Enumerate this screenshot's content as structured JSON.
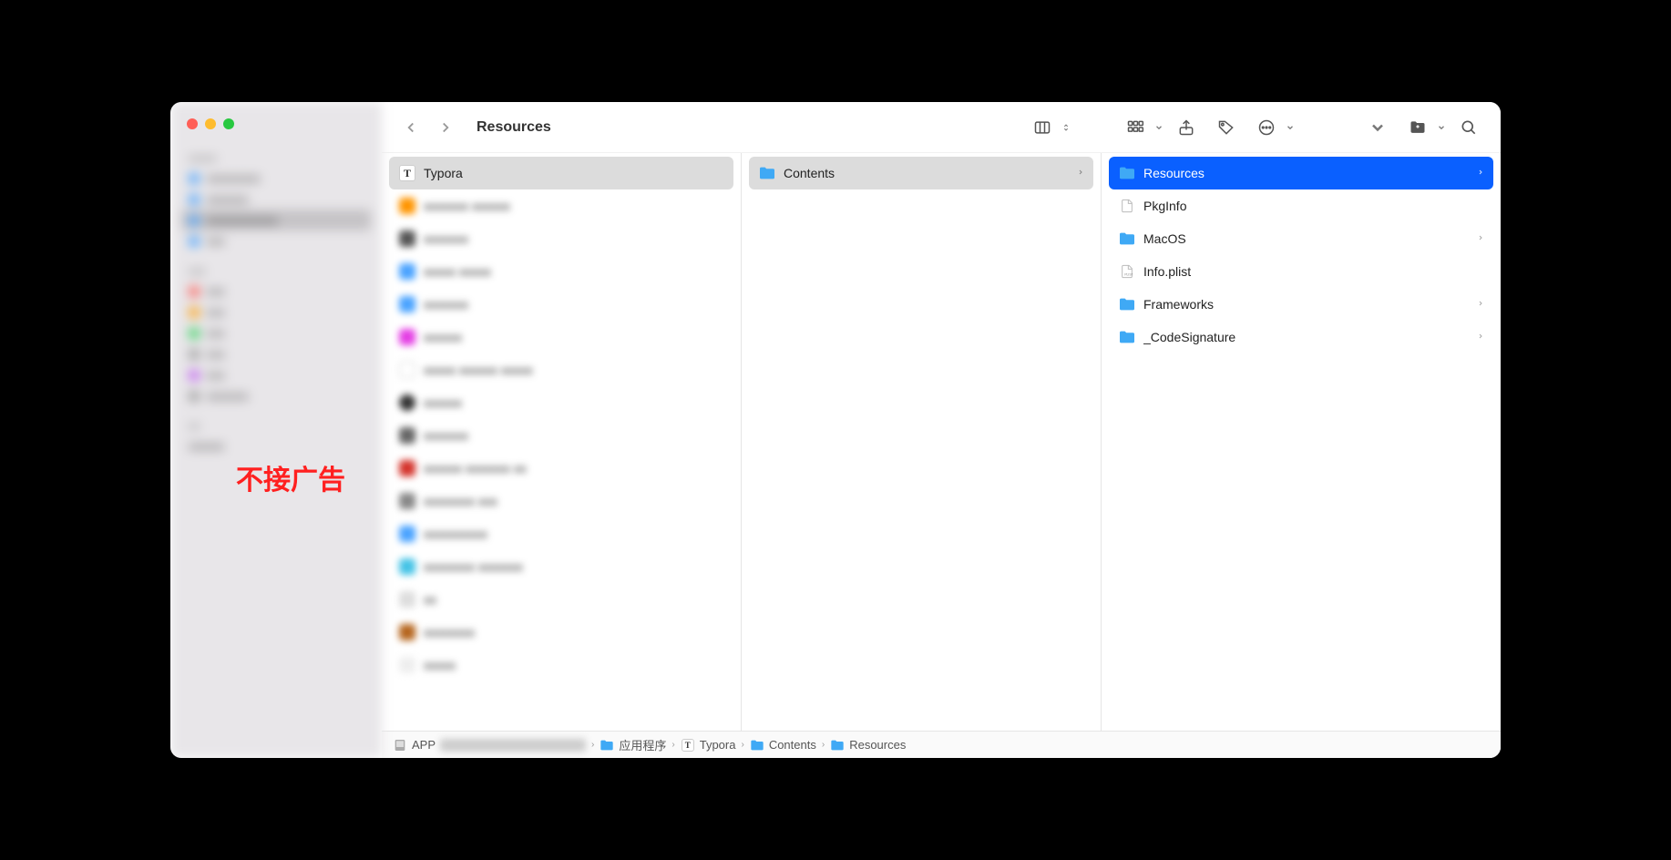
{
  "window_title": "Resources",
  "overlay_annotation": "不接广告",
  "columns": [
    {
      "header": {
        "label": "Typora",
        "icon": "t"
      },
      "items": []
    },
    {
      "header": {
        "label": "Contents",
        "icon": "folder",
        "has_chevron": true
      },
      "items": []
    },
    {
      "selected": {
        "label": "Resources",
        "icon": "folder"
      },
      "items": [
        {
          "label": "PkgInfo",
          "icon": "file",
          "has_chevron": false
        },
        {
          "label": "MacOS",
          "icon": "folder",
          "has_chevron": true
        },
        {
          "label": "Info.plist",
          "icon": "plist",
          "has_chevron": false
        },
        {
          "label": "Frameworks",
          "icon": "folder",
          "has_chevron": true
        },
        {
          "label": "_CodeSignature",
          "icon": "folder",
          "has_chevron": true
        }
      ]
    }
  ],
  "pathbar": {
    "segments": [
      {
        "label": "APP",
        "icon": "disk"
      },
      {
        "label": "应用程序",
        "icon": "folder"
      },
      {
        "label": "Typora",
        "icon": "t"
      },
      {
        "label": "Contents",
        "icon": "folder"
      },
      {
        "label": "Resources",
        "icon": "folder"
      }
    ]
  }
}
